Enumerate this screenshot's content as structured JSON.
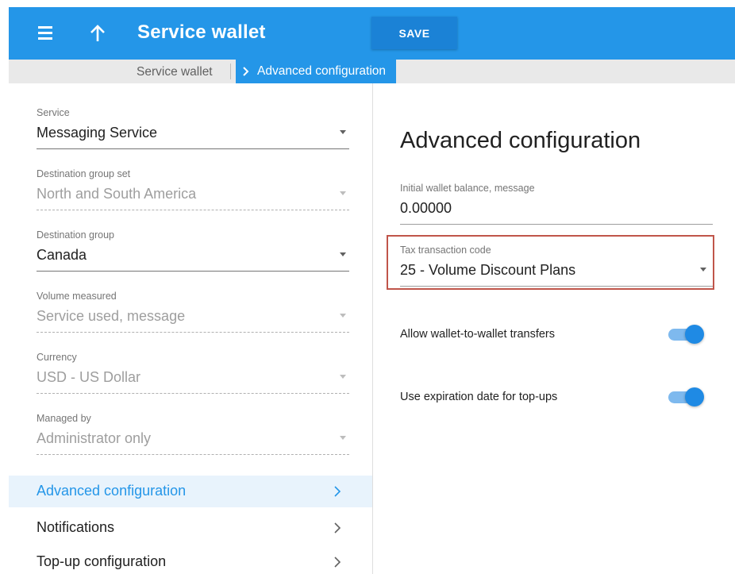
{
  "header": {
    "title": "Service wallet",
    "save_label": "SAVE",
    "menu_icon": "hamburger-menu-icon",
    "up_icon": "arrow-up-icon"
  },
  "breadcrumb": {
    "items": [
      "Service wallet",
      "Advanced configuration"
    ]
  },
  "left_form": {
    "fields": [
      {
        "label": "Service",
        "value": "Messaging Service",
        "enabled": true
      },
      {
        "label": "Destination group set",
        "value": "North and South America",
        "enabled": false
      },
      {
        "label": "Destination group",
        "value": "Canada",
        "enabled": true
      },
      {
        "label": "Volume measured",
        "value": "Service used, message",
        "enabled": false
      },
      {
        "label": "Currency",
        "value": "USD - US Dollar",
        "enabled": false
      },
      {
        "label": "Managed by",
        "value": "Administrator only",
        "enabled": false
      }
    ],
    "nav": [
      {
        "label": "Advanced configuration",
        "active": true
      },
      {
        "label": "Notifications",
        "active": false
      },
      {
        "label": "Top-up configuration",
        "active": false
      }
    ]
  },
  "right_panel": {
    "title": "Advanced configuration",
    "initial_balance": {
      "label": "Initial wallet balance, message",
      "value": "0.00000"
    },
    "tax_code": {
      "label": "Tax transaction code",
      "value": "25 - Volume Discount Plans"
    },
    "toggles": [
      {
        "label": "Allow wallet-to-wallet transfers",
        "on": true
      },
      {
        "label": "Use expiration date for top-ups",
        "on": true
      }
    ]
  },
  "colors": {
    "accent": "#2496e8",
    "highlight_border": "#c0554a"
  }
}
